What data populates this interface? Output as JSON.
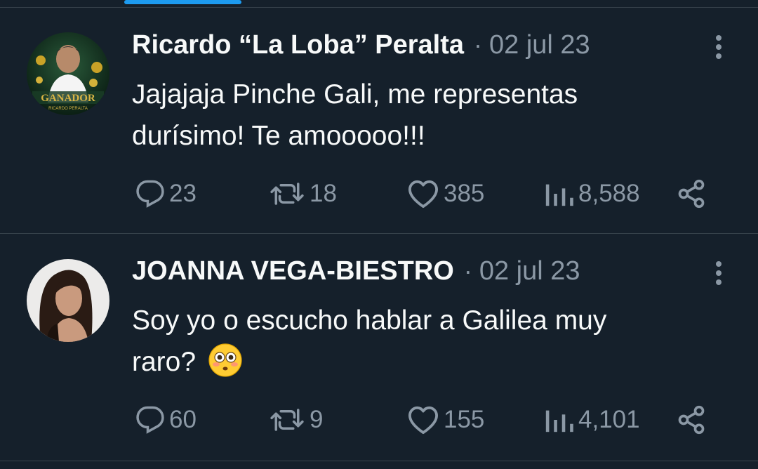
{
  "tweets": [
    {
      "author_name": "Ricardo “La Loba” Peralta",
      "separator": "·",
      "date": "02 jul 23",
      "text_line1": "Jajajaja Pinche Gali, me representas",
      "text_line2": "durísimo! Te amooooo!!!",
      "avatar_caption": "GANADOR",
      "avatar_subcaption": "RICARDO PERALTA",
      "replies": "23",
      "retweets": "18",
      "likes": "385",
      "views": "8,588"
    },
    {
      "author_name": "JOANNA VEGA-BIESTRO",
      "separator": "·",
      "date": "02 jul 23",
      "text_line1": "Soy yo o escucho hablar a Galilea muy",
      "text_line2": "raro?",
      "emoji": "flushed-face-emoji",
      "replies": "60",
      "retweets": "9",
      "likes": "155",
      "views": "4,101"
    }
  ],
  "icons": {
    "reply": "reply-icon",
    "retweet": "retweet-icon",
    "like": "heart-icon",
    "views": "views-bar-chart-icon",
    "share": "share-icon",
    "more": "more-options-icon"
  },
  "colors": {
    "background": "#15202b",
    "divider": "#38444d",
    "primary_text": "#f7f9f9",
    "secondary_text": "#8b98a5",
    "accent": "#1d9bf0"
  }
}
